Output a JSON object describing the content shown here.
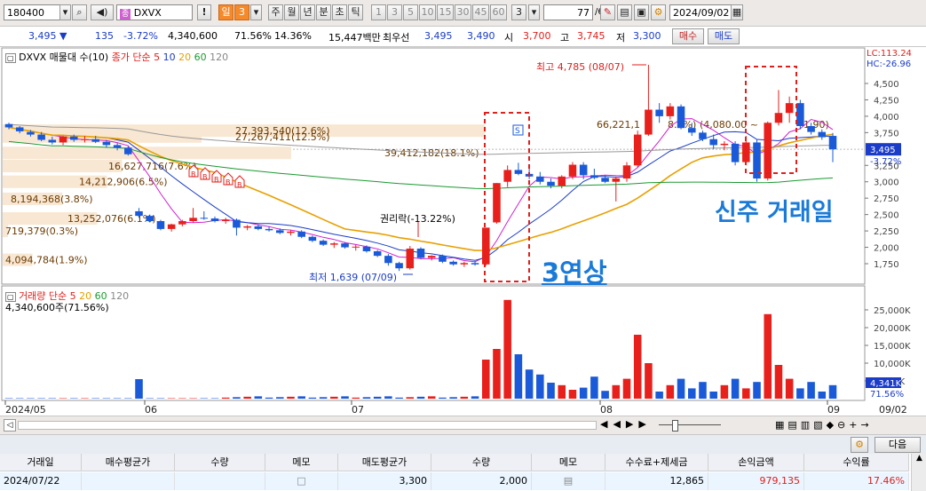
{
  "toolbar": {
    "code": "180400",
    "name": "DXVX",
    "btn_excl": "!",
    "periods": [
      "일",
      "3",
      "주",
      "월",
      "년",
      "분",
      "초",
      "틱",
      "1",
      "3",
      "5",
      "10",
      "15",
      "30",
      "45",
      "60",
      "3"
    ],
    "count": "77",
    "count_total": "/600",
    "date": "2024/09/02"
  },
  "quote": {
    "price": "3,495",
    "arrow": "▼",
    "change": "135",
    "change_pct": "-3.72%",
    "volume": "4,340,600",
    "vol_ratio": "71.56%",
    "turnover": "14.36%",
    "amount": "15,447백만",
    "best_label": "최우선",
    "best_ask": "3,495",
    "best_bid": "3,490",
    "open_label": "시",
    "open": "3,700",
    "high_label": "고",
    "high": "3,745",
    "low_label": "저",
    "low": "3,300",
    "buy_label": "매수",
    "sell_label": "매도"
  },
  "chart": {
    "legend_main": "DXVX 매물대 수(10)",
    "legend_ma_label": "종가 단순 5",
    "legend_ma": [
      "10",
      "20",
      "60",
      "120"
    ],
    "lc": "LC:113.24",
    "hc": "HC:-26.96",
    "price_ticks": [
      "4,500",
      "4,250",
      "4,000",
      "3,750",
      "3,250",
      "3,000",
      "2,750",
      "2,500",
      "2,250",
      "2,000",
      "1,750"
    ],
    "last_price": "3,495",
    "last_pct": "-3.72%",
    "volume_profile": [
      "27,393,540(12.6%)",
      "27,267,411(12.5%)",
      "39,412,182(18.1%)",
      "16,627,716(7.6%)",
      "14,212,906(6.5%)",
      "8,194,368(3.8%)",
      "13,252,076(6.1%)",
      "719,379(0.3%)",
      "4,094,784(1.9%)",
      "66,221,1"
    ],
    "high_note": "최고 4,785 (08/07)",
    "low_note": "최저 1,639 (07/09)",
    "rights_note": "권리락(-13.22%)",
    "range_note": "(4,080.00 ~",
    "range_note2": "1.90)",
    "pct_note": "8.4%)",
    "new_share": "신주 거래일",
    "three_up": "3연상",
    "vol_legend": "거래량 단순 5",
    "vol_legend_ma": [
      "20",
      "60",
      "120"
    ],
    "vol_info": "4,340,600주(71.56%)",
    "vol_ticks": [
      "25,000K",
      "20,000K",
      "15,000K",
      "10,000K",
      "5,000K"
    ],
    "vol_last": "4,341K",
    "vol_pct": "71.56%",
    "months": [
      "2024/05",
      "06",
      "07",
      "08",
      "09"
    ],
    "date_right": "09/02",
    "b_marks": [
      "B",
      "B",
      "B",
      "B",
      "B"
    ],
    "s_mark": "S"
  },
  "chart_data": {
    "type": "candlestick",
    "title": "DXVX",
    "price_axis": [
      1750,
      4500
    ],
    "candles": [
      [
        3880,
        3900,
        3800,
        3830
      ],
      [
        3830,
        3850,
        3740,
        3770
      ],
      [
        3760,
        3790,
        3690,
        3720
      ],
      [
        3720,
        3760,
        3620,
        3640
      ],
      [
        3640,
        3690,
        3570,
        3600
      ],
      [
        3600,
        3700,
        3560,
        3690
      ],
      [
        3690,
        3720,
        3610,
        3640
      ],
      [
        3640,
        3700,
        3600,
        3650
      ],
      [
        3650,
        3700,
        3590,
        3610
      ],
      [
        3610,
        3640,
        3520,
        3560
      ],
      [
        3560,
        3600,
        3480,
        3520
      ],
      [
        3520,
        3540,
        3400,
        3420
      ],
      [
        2550,
        2600,
        2450,
        2480
      ],
      [
        2480,
        2500,
        2380,
        2400
      ],
      [
        2400,
        2420,
        2260,
        2280
      ],
      [
        2280,
        2360,
        2240,
        2350
      ],
      [
        2350,
        2420,
        2320,
        2400
      ],
      [
        2400,
        2600,
        2380,
        2450
      ],
      [
        2450,
        2550,
        2420,
        2440
      ],
      [
        2440,
        2470,
        2380,
        2400
      ],
      [
        2400,
        2450,
        2360,
        2420
      ],
      [
        2420,
        2440,
        2180,
        2300
      ],
      [
        2300,
        2340,
        2260,
        2320
      ],
      [
        2320,
        2350,
        2260,
        2280
      ],
      [
        2280,
        2320,
        2240,
        2260
      ],
      [
        2260,
        2290,
        2200,
        2220
      ],
      [
        2220,
        2260,
        2180,
        2240
      ],
      [
        2240,
        2260,
        2140,
        2160
      ],
      [
        2160,
        2180,
        2080,
        2100
      ],
      [
        2100,
        2120,
        2020,
        2040
      ],
      [
        2040,
        2080,
        1990,
        2060
      ],
      [
        2060,
        2080,
        1980,
        2000
      ],
      [
        2000,
        2040,
        1950,
        2010
      ],
      [
        2010,
        2030,
        1920,
        1940
      ],
      [
        1940,
        1960,
        1850,
        1870
      ],
      [
        1870,
        1900,
        1720,
        1760
      ],
      [
        1760,
        1780,
        1639,
        1680
      ],
      [
        1680,
        2020,
        1660,
        1980
      ],
      [
        1980,
        2000,
        1820,
        1840
      ],
      [
        1840,
        1880,
        1800,
        1870
      ],
      [
        1870,
        1890,
        1760,
        1780
      ],
      [
        1780,
        1800,
        1720,
        1740
      ],
      [
        1740,
        1780,
        1700,
        1760
      ],
      [
        1760,
        1790,
        1720,
        1740
      ],
      [
        1740,
        2300,
        1720,
        2300
      ],
      [
        2380,
        2980,
        2360,
        2980
      ],
      [
        3000,
        3250,
        2920,
        3180
      ],
      [
        3180,
        3290,
        3100,
        3120
      ],
      [
        3120,
        3200,
        3040,
        3080
      ],
      [
        3080,
        3150,
        2960,
        3000
      ],
      [
        3000,
        3050,
        2900,
        2940
      ],
      [
        2940,
        3100,
        2900,
        3080
      ],
      [
        3080,
        3300,
        3040,
        3260
      ],
      [
        3260,
        3300,
        3040,
        3100
      ],
      [
        3100,
        3200,
        3040,
        3060
      ],
      [
        3060,
        3100,
        2980,
        3000
      ],
      [
        3000,
        3080,
        2700,
        3050
      ],
      [
        3050,
        3300,
        3000,
        3250
      ],
      [
        3250,
        3780,
        3220,
        3720
      ],
      [
        3720,
        4785,
        3700,
        4100
      ],
      [
        4100,
        4200,
        3900,
        4000
      ],
      [
        4000,
        4200,
        3950,
        4150
      ],
      [
        4150,
        4180,
        3800,
        3820
      ],
      [
        3820,
        3900,
        3700,
        3750
      ],
      [
        3750,
        3780,
        3620,
        3650
      ],
      [
        3650,
        3720,
        3500,
        3560
      ],
      [
        3560,
        3620,
        3480,
        3580
      ],
      [
        3580,
        3620,
        3250,
        3300
      ],
      [
        3300,
        3700,
        3280,
        3600
      ],
      [
        3600,
        3650,
        3000,
        3050
      ],
      [
        3050,
        3920,
        3020,
        3900
      ],
      [
        3900,
        4400,
        3860,
        4050
      ],
      [
        4050,
        4300,
        3900,
        4200
      ],
      [
        4200,
        4250,
        3800,
        3850
      ],
      [
        3850,
        3900,
        3720,
        3760
      ],
      [
        3760,
        3800,
        3640,
        3680
      ],
      [
        3700,
        3745,
        3300,
        3495
      ]
    ]
  }
}
